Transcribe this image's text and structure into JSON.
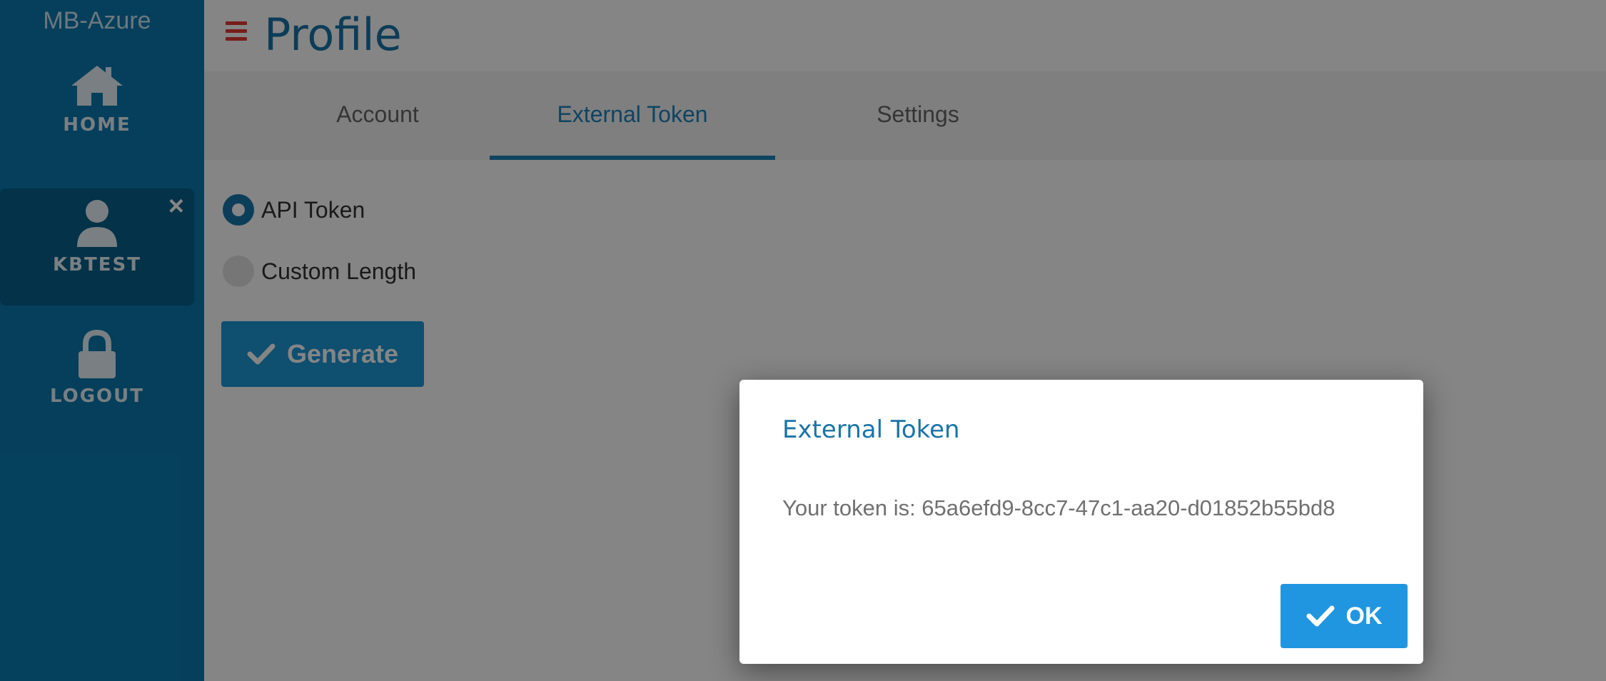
{
  "sidebar": {
    "app_name": "MB-Azure",
    "items": [
      {
        "label": "HOME",
        "icon": "home-icon"
      },
      {
        "label": "KBTEST",
        "icon": "user-icon",
        "close": "×"
      },
      {
        "label": "LOGOUT",
        "icon": "lock-icon"
      }
    ]
  },
  "header": {
    "title": "Profile",
    "menu_icon": "hamburger-icon"
  },
  "tabs": [
    {
      "label": "Account"
    },
    {
      "label": "External Token",
      "active": true
    },
    {
      "label": "Settings"
    }
  ],
  "form": {
    "options": [
      {
        "label": "API Token",
        "selected": true
      },
      {
        "label": "Custom Length",
        "selected": false
      }
    ],
    "generate_label": "Generate"
  },
  "dialog": {
    "title": "External Token",
    "message": "Your token is: 65a6efd9-8cc7-47c1-aa20-d01852b55bd8",
    "ok_label": "OK"
  },
  "colors": {
    "sidebar": "#0a7ab0",
    "accent": "#1d82b9",
    "menu_icon": "#e53935",
    "button": "#1d97d6"
  }
}
